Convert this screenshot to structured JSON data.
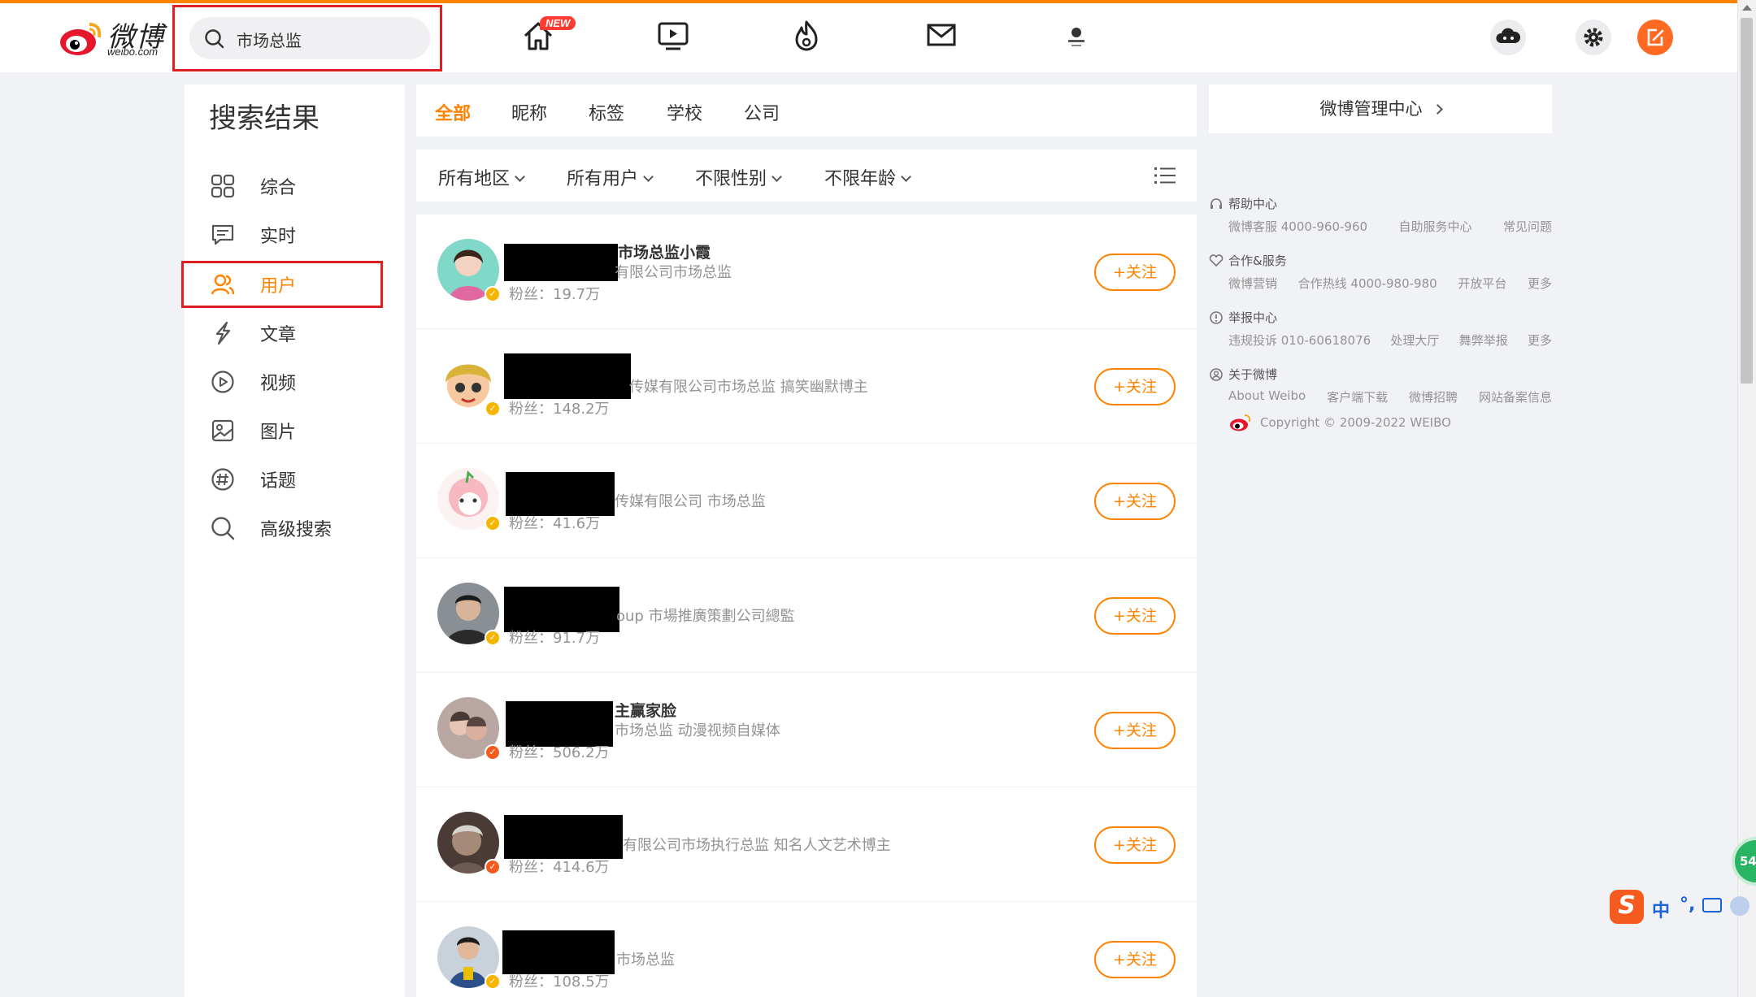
{
  "header": {
    "logo_text": "微博",
    "logo_sub": "weibo.com",
    "search_value": "市场总监",
    "new_badge": "NEW"
  },
  "sidebar": {
    "title": "搜索结果",
    "items": [
      {
        "label": "综合",
        "icon": "grid-icon"
      },
      {
        "label": "实时",
        "icon": "message-icon"
      },
      {
        "label": "用户",
        "icon": "users-icon"
      },
      {
        "label": "文章",
        "icon": "lightning-icon"
      },
      {
        "label": "视频",
        "icon": "play-icon"
      },
      {
        "label": "图片",
        "icon": "image-icon"
      },
      {
        "label": "话题",
        "icon": "hashtag-icon"
      },
      {
        "label": "高级搜索",
        "icon": "search-icon"
      }
    ],
    "active": "用户"
  },
  "tabs": [
    "全部",
    "昵称",
    "标签",
    "学校",
    "公司"
  ],
  "filters": [
    "所有地区",
    "所有用户",
    "不限性别",
    "不限年龄"
  ],
  "users": [
    {
      "name": "市场总监小霞",
      "desc": "有限公司市场总监",
      "fans": "粉丝：19.7万",
      "follow": "+关注"
    },
    {
      "name": "",
      "desc": "传媒有限公司市场总监 搞笑幽默博主",
      "fans": "粉丝：148.2万",
      "follow": "+关注"
    },
    {
      "name": "",
      "desc": "传媒有限公司 市场总监",
      "fans": "粉丝：41.6万",
      "follow": "+关注"
    },
    {
      "name": "",
      "desc": "oup 市場推廣策劃公司總監",
      "fans": "粉丝：91.7万",
      "follow": "+关注"
    },
    {
      "name": "主赢家脸",
      "desc": "市场总监 动漫视频自媒体",
      "fans": "粉丝：506.2万",
      "follow": "+关注"
    },
    {
      "name": "",
      "desc": "有限公司市场执行总监 知名人文艺术博主",
      "fans": "粉丝：414.6万",
      "follow": "+关注"
    },
    {
      "name": "",
      "desc": "市场总监",
      "fans": "粉丝：108.5万",
      "follow": "+关注"
    }
  ],
  "right": {
    "manage": "微博管理中心",
    "help": {
      "title": "帮助中心",
      "links": [
        "微博客服 4000-960-960",
        "自助服务中心",
        "常见问题"
      ]
    },
    "coop": {
      "title": "合作&服务",
      "links": [
        "微博营销",
        "合作热线 4000-980-980",
        "开放平台",
        "更多"
      ]
    },
    "report": {
      "title": "举报中心",
      "links": [
        "违规投诉 010-60618076",
        "处理大厅",
        "舞弊举报",
        "更多"
      ]
    },
    "about": {
      "title": "关于微博",
      "links": [
        "About Weibo",
        "客户端下载",
        "微博招聘",
        "网站备案信息"
      ]
    },
    "copyright": "Copyright © 2009-2022 WEIBO"
  },
  "overlay": {
    "badge": "54",
    "ime_logo": "S",
    "ime_lang": "中",
    "ime_punct": "°,"
  },
  "colors": {
    "accent": "#ff8200",
    "highlight": "#e02020"
  }
}
